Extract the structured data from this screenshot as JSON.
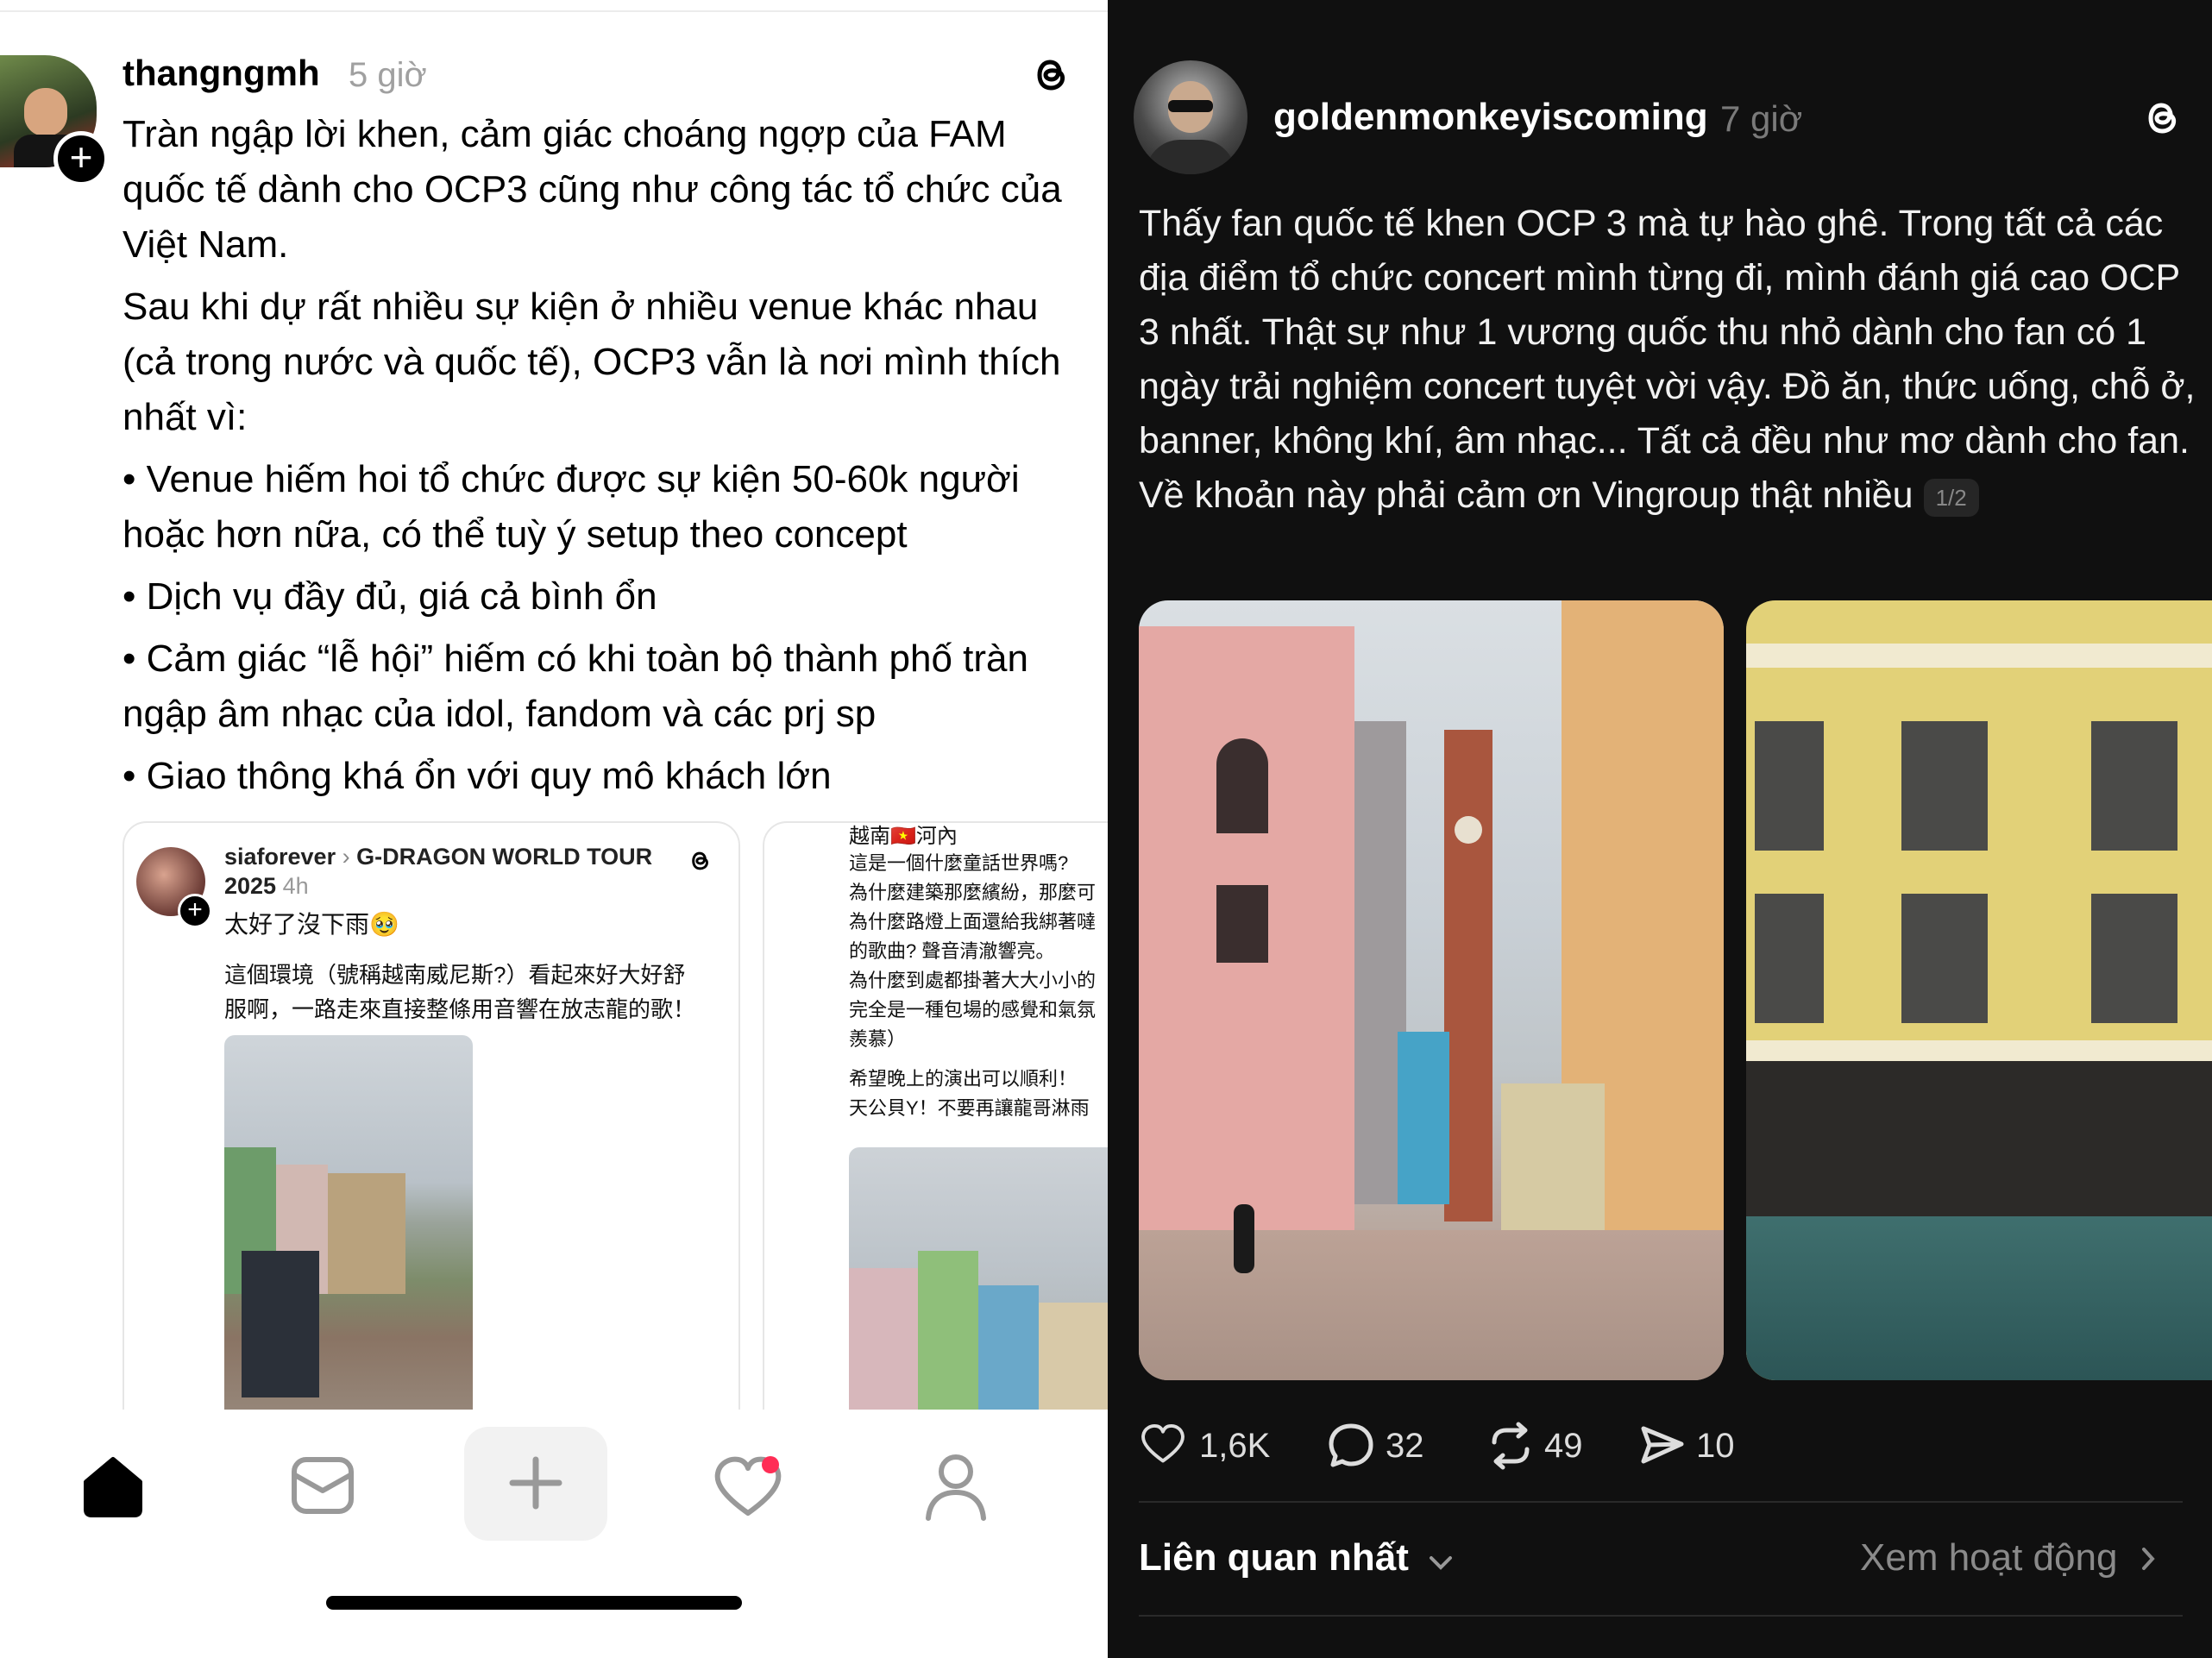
{
  "left_post": {
    "username": "thangngmh",
    "time": "5 giờ",
    "paragraphs": [
      "Tràn ngập lời khen, cảm giác choáng ngợp của FAM quốc tế dành cho OCP3 cũng như công tác tổ chức của Việt Nam.",
      "Sau khi dự rất nhiều sự kiện ở nhiều venue khác nhau (cả trong nước và quốc tế), OCP3 vẫn là nơi mình thích nhất vì:"
    ],
    "bullets": [
      "• Venue hiếm hoi tổ chức được sự kiện 50-60k người hoặc hơn nữa, có thể tuỳ ý setup theo concept",
      "• Dịch vụ đầy đủ, giá cả bình ổn",
      "• Cảm giác “lễ hội” hiếm có khi toàn bộ thành phố tràn ngập âm nhạc của idol, fandom và các prj sp",
      "• Giao thông khá ổn với quy mô khách lớn"
    ],
    "quote1": {
      "username": "siaforever",
      "topic": "G-DRAGON WORLD TOUR 2025",
      "time": "4h",
      "line1": "太好了沒下雨🥹",
      "line2": "這個環境（號稱越南威尼斯?）看起來好大好舒服啊，一路走來直接整條用音響在放志龍的歌！"
    },
    "quote2": {
      "location": "越南🇻🇳河內",
      "lines": [
        "這是一個什麼童話世界嗎?",
        "為什麼建築那麼繽紛，那麼可",
        "為什麼路燈上面還給我綁著噠",
        "的歌曲? 聲音清澈響亮。",
        "為什麼到處都掛著大大小小的",
        "完全是一種包場的感覺和氣氛",
        "羨慕）",
        "希望晚上的演出可以順利！",
        "天公貝Y！不要再讓龍哥淋雨"
      ]
    }
  },
  "right_post": {
    "username": "goldenmonkeyiscoming",
    "time": "7 giờ",
    "text": "Thấy fan quốc tế khen OCP 3 mà tự hào ghê. Trong tất cả các địa điểm tổ chức concert mình từng đi, mình đánh giá cao OCP 3 nhất. Thật sự như 1 vương quốc thu nhỏ dành cho fan có 1 ngày trải nghiệm concert tuyệt vời vậy. Đồ ăn, thức uống, chỗ ở, banner, không khí, âm nhạc... Tất cả đều như mơ dành cho fan. Về khoản này phải cảm ơn Vingroup thật nhiều",
    "page_indicator": "1/2",
    "likes": "1,6K",
    "comments": "32",
    "reposts": "49",
    "shares": "10",
    "sort_label": "Liên quan nhất",
    "activity_link": "Xem hoạt động"
  },
  "icons": {
    "threads": "threads-icon",
    "home": "home-icon",
    "inbox": "inbox-icon",
    "create": "plus-icon",
    "activity": "heart-icon",
    "profile": "profile-icon"
  }
}
